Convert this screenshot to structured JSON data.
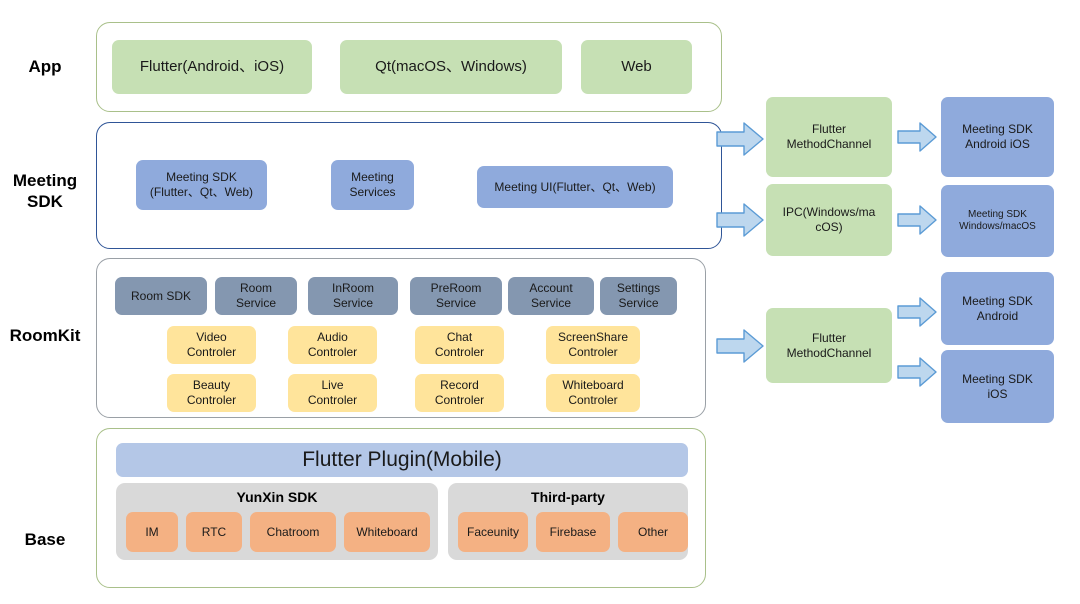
{
  "diagram": {
    "title": "Meeting SDK layered architecture",
    "colors": {
      "app_fill": "#c6e0b4",
      "sdk_fill": "#8faadc",
      "service_fill": "#8497b0",
      "controller_fill": "#ffe49b",
      "base_item_fill": "#f4b183",
      "plugin_fill": "#b4c7e7",
      "group_fill": "#d9d9d9",
      "arrow_fill": "#bdd7ee",
      "arrow_stroke": "#5b9bd5",
      "app_border": "#a9c08a",
      "meeting_border": "#2f5597",
      "roomkit_border": "#9aa0a6",
      "base_border": "#a9c08a"
    }
  },
  "rows": {
    "app": "App",
    "meeting_sdk": "Meeting\nSDK",
    "roomkit": "RoomKit",
    "base": "Base"
  },
  "app_layer": {
    "items": [
      {
        "label": "Flutter(Android、iOS)"
      },
      {
        "label": "Qt(macOS、Windows)"
      },
      {
        "label": "Web"
      }
    ]
  },
  "meeting_sdk_layer": {
    "items": [
      {
        "label": "Meeting SDK\n(Flutter、Qt、Web)"
      },
      {
        "label": "Meeting\nServices"
      },
      {
        "label": "Meeting UI(Flutter、Qt、Web)"
      }
    ]
  },
  "roomkit_layer": {
    "services": [
      {
        "label": "Room SDK"
      },
      {
        "label": "Room\nService"
      },
      {
        "label": "InRoom\nService"
      },
      {
        "label": "PreRoom\nService"
      },
      {
        "label": "Account\nService"
      },
      {
        "label": "Settings\nService"
      }
    ],
    "controllers_row1": [
      {
        "label": "Video\nControler"
      },
      {
        "label": "Audio\nControler"
      },
      {
        "label": "Chat\nControler"
      },
      {
        "label": "ScreenShare\nControler"
      }
    ],
    "controllers_row2": [
      {
        "label": "Beauty\nControler"
      },
      {
        "label": "Live\nControler"
      },
      {
        "label": "Record\nControler"
      },
      {
        "label": "Whiteboard\nControler"
      }
    ]
  },
  "base_layer": {
    "plugin": "Flutter Plugin(Mobile)",
    "groups": [
      {
        "title": "YunXin SDK",
        "items": [
          {
            "label": "IM"
          },
          {
            "label": "RTC"
          },
          {
            "label": "Chatroom"
          },
          {
            "label": "Whiteboard"
          }
        ]
      },
      {
        "title": "Third-party",
        "items": [
          {
            "label": "Faceunity"
          },
          {
            "label": "Firebase"
          },
          {
            "label": "Other"
          }
        ]
      }
    ]
  },
  "bridges": {
    "items": [
      {
        "label": "Flutter\nMethodChannel"
      },
      {
        "label": "IPC(Windows/ma\ncOS)"
      },
      {
        "label": "Flutter\nMethodChannel"
      }
    ]
  },
  "targets": {
    "items": [
      {
        "label": "Meeting SDK\nAndroid iOS"
      },
      {
        "label": "Meeting SDK\nWindows/macOS"
      },
      {
        "label": "Meeting SDK\nAndroid"
      },
      {
        "label": "Meeting SDK\niOS"
      }
    ]
  }
}
